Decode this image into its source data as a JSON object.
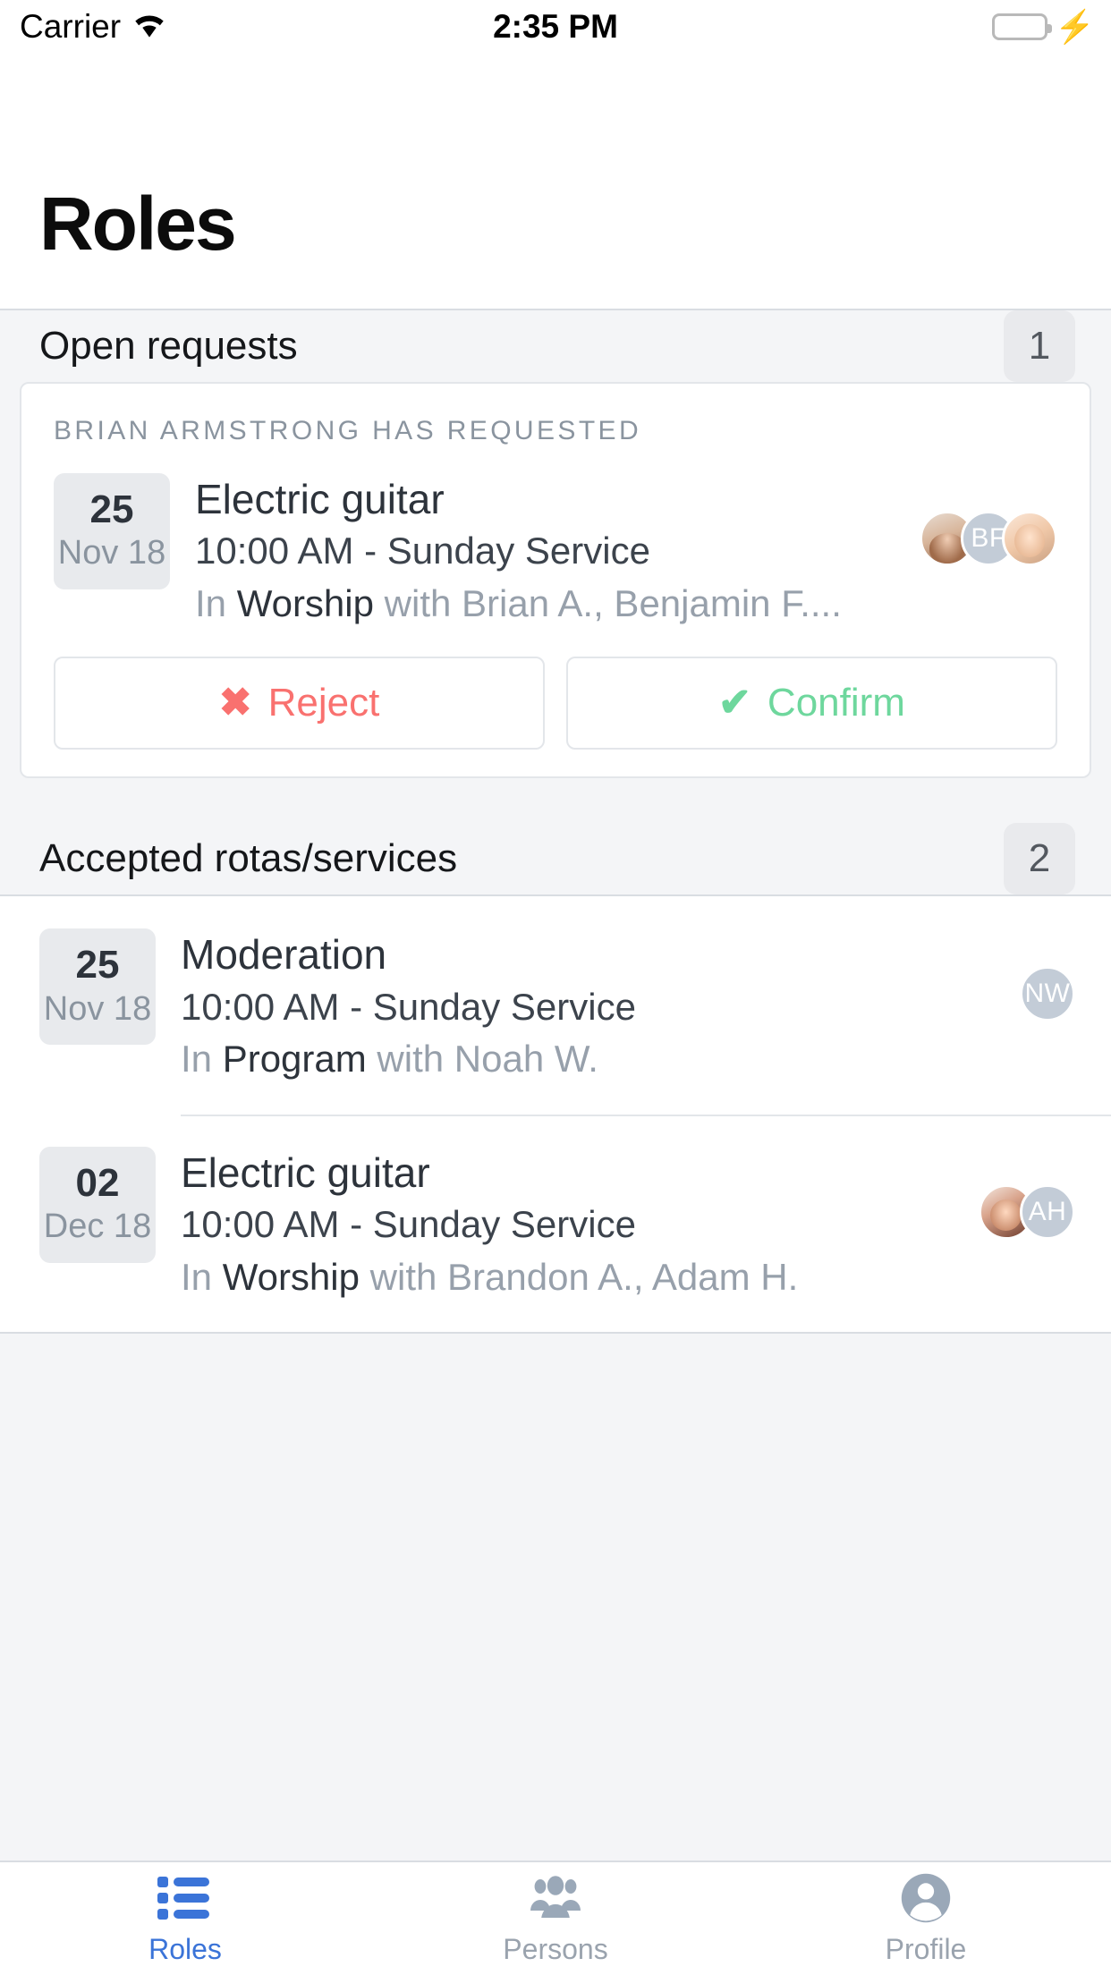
{
  "status_bar": {
    "carrier": "Carrier",
    "wifi_icon": "wifi-icon",
    "time": "2:35 PM",
    "battery_icon": "battery-icon",
    "charging_icon": "lightning-bolt-icon"
  },
  "header": {
    "title": "Roles"
  },
  "open_requests": {
    "section_title": "Open requests",
    "count": "1",
    "card": {
      "kicker": "Brian Armstrong has requested",
      "date_day": "25",
      "date_month": "Nov 18",
      "title": "Electric guitar",
      "subtitle": "10:00 AM - Sunday Service",
      "meta_prefix": "In ",
      "meta_team": "Worship",
      "meta_people": " with Brian A., Benjamin F....",
      "avatars": [
        {
          "type": "photo",
          "initials": ""
        },
        {
          "type": "initials",
          "initials": "BF"
        },
        {
          "type": "photo",
          "initials": ""
        }
      ],
      "reject_label": "Reject",
      "reject_icon": "cross-icon",
      "reject_glyph": "✖",
      "reject_color": "#f9716f",
      "confirm_label": "Confirm",
      "confirm_icon": "check-icon",
      "confirm_glyph": "✔",
      "confirm_color": "#6ed79d"
    }
  },
  "accepted": {
    "section_title": "Accepted rotas/services",
    "count": "2",
    "rows": [
      {
        "date_day": "25",
        "date_month": "Nov 18",
        "title": "Moderation",
        "subtitle": "10:00 AM - Sunday Service",
        "meta_prefix": "In ",
        "meta_team": "Program",
        "meta_people": " with Noah W.",
        "avatars": [
          {
            "type": "initials",
            "initials": "NW"
          }
        ]
      },
      {
        "date_day": "02",
        "date_month": "Dec 18",
        "title": "Electric guitar",
        "subtitle": "10:00 AM - Sunday Service",
        "meta_prefix": "In ",
        "meta_team": "Worship",
        "meta_people": " with Brandon A., Adam H.",
        "avatars": [
          {
            "type": "photo",
            "initials": ""
          },
          {
            "type": "initials",
            "initials": "AH"
          }
        ]
      }
    ]
  },
  "tabbar": {
    "tabs": [
      {
        "label": "Roles",
        "icon": "list-icon",
        "active": true
      },
      {
        "label": "Persons",
        "icon": "people-icon",
        "active": false
      },
      {
        "label": "Profile",
        "icon": "person-circle-icon",
        "active": false
      }
    ],
    "active_color": "#3b74d8",
    "inactive_color": "#9aa3ae"
  }
}
